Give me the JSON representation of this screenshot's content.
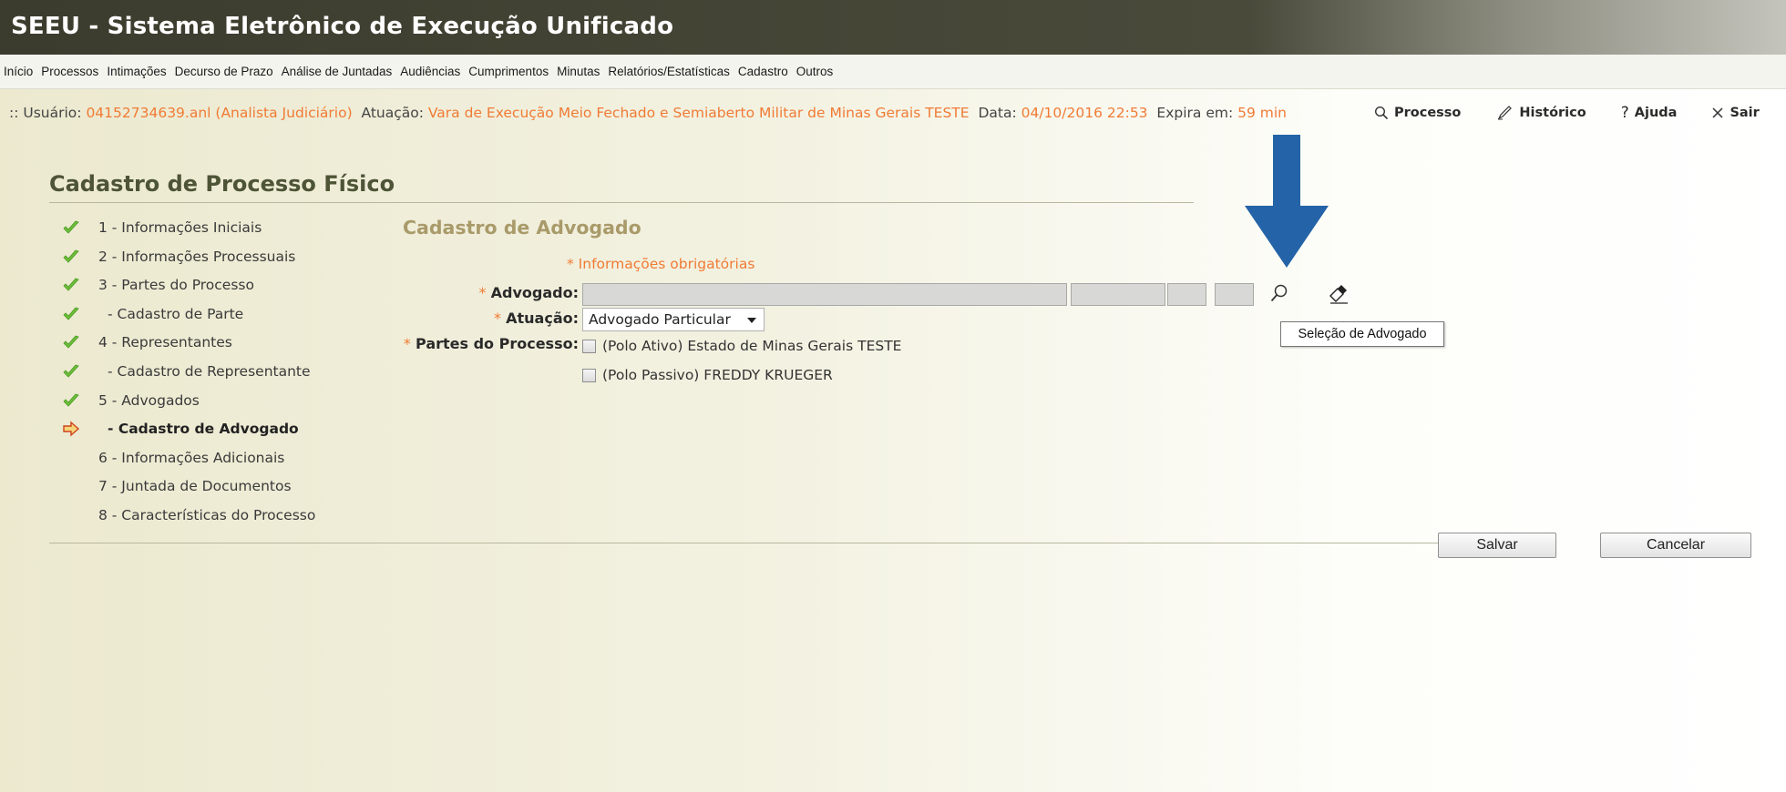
{
  "app": {
    "title": "SEEU - Sistema Eletrônico de Execução Unificado"
  },
  "menu": [
    "Início",
    "Processos",
    "Intimações",
    "Decurso de Prazo",
    "Análise de Juntadas",
    "Audiências",
    "Cumprimentos",
    "Minutas",
    "Relatórios/Estatísticas",
    "Cadastro",
    "Outros"
  ],
  "user_bar": {
    "prefix": ":: Usuário:",
    "user": "04152734639.anl (Analista Judiciário)",
    "atuacao_label": "Atuação:",
    "atuacao": "Vara de Execução Meio Fechado e Semiaberto Militar de Minas Gerais TESTE",
    "data_label": "Data:",
    "data": "04/10/2016 22:53",
    "expira_label": "Expira em:",
    "expira": "59 min"
  },
  "top_links": {
    "processo": "Processo",
    "historico": "Histórico",
    "ajuda": "Ajuda",
    "sair": "Sair"
  },
  "page_title": "Cadastro de Processo Físico",
  "steps": [
    {
      "label": "1 - Informações Iniciais",
      "state": "done"
    },
    {
      "label": "2 - Informações Processuais",
      "state": "done"
    },
    {
      "label": "3 - Partes do Processo",
      "state": "done"
    },
    {
      "label": "- Cadastro de Parte",
      "state": "done"
    },
    {
      "label": "4 - Representantes",
      "state": "done"
    },
    {
      "label": "- Cadastro de Representante",
      "state": "done"
    },
    {
      "label": "5 - Advogados",
      "state": "done"
    },
    {
      "label": "- Cadastro de Advogado",
      "state": "current"
    },
    {
      "label": "6 - Informações Adicionais",
      "state": "pending"
    },
    {
      "label": "7 - Juntada de Documentos",
      "state": "pending"
    },
    {
      "label": "8 - Características do Processo",
      "state": "pending"
    }
  ],
  "form": {
    "section_title": "Cadastro de Advogado",
    "required_note": "* Informações obrigatórias",
    "advogado_label": "Advogado:",
    "atuacao_label": "Atuação:",
    "atuacao_value": "Advogado Particular",
    "partes_label": "Partes do Processo:",
    "partes": [
      "(Polo Ativo) Estado de Minas Gerais TESTE",
      "(Polo Passivo) FREDDY KRUEGER"
    ],
    "tooltip": "Seleção de Advogado"
  },
  "buttons": {
    "save": "Salvar",
    "cancel": "Cancelar"
  },
  "colors": {
    "accent_orange": "#f07b35",
    "title_olive": "#4e5436",
    "section_tan": "#a99a6a",
    "annotation_arrow": "#2463a7",
    "check_green": "#6dbf3a"
  }
}
